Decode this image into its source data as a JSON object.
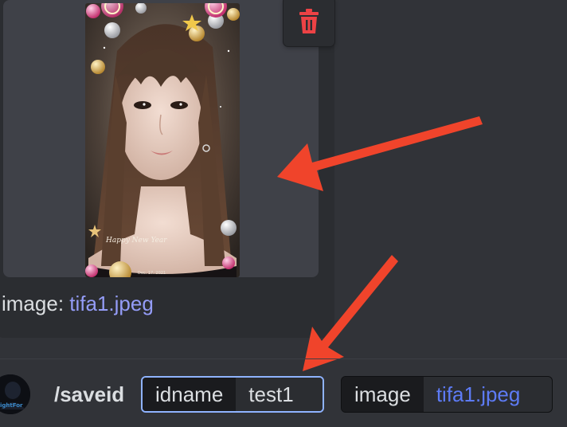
{
  "attachment": {
    "image_alt": "uploaded portrait image",
    "overlay_small_text": "Dec. 17. 2021",
    "overlay_script_text": "Happy New Year",
    "caption_key": "image:",
    "caption_filename": "tifa1.jpeg"
  },
  "delete_button": {
    "icon": "trash-icon",
    "color": "#ed4245"
  },
  "composer": {
    "avatar_text": "ightFor",
    "command": "/saveid",
    "options": [
      {
        "name": "idname",
        "value": "test1"
      },
      {
        "name": "image",
        "value": "tifa1.jpeg"
      }
    ]
  },
  "colors": {
    "background": "#313338",
    "card": "#2b2d31",
    "link": "#949cf7",
    "arrow": "#f0442b",
    "focus_border": "#8fb3ff"
  }
}
